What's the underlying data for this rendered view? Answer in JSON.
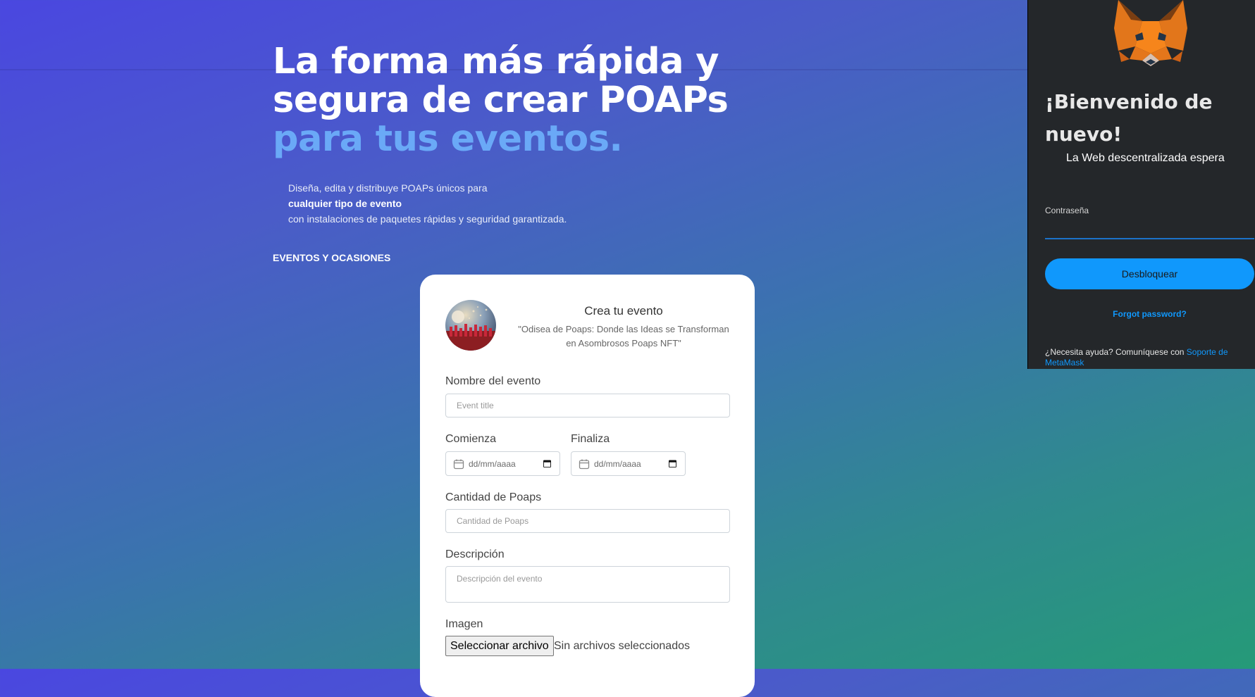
{
  "hero": {
    "line1": "La forma más rápida y",
    "line2": "segura de crear POAPs",
    "line3": "para tus eventos.",
    "desc1": "Diseña, edita y distribuye POAPs únicos para",
    "desc2": "cualquier tipo de evento",
    "desc3": "con instalaciones de paquetes rápidas y seguridad garantizada.",
    "section_label": "EVENTOS Y OCASIONES"
  },
  "form": {
    "title": "Crea tu evento",
    "subtitle": "\"Odisea de Poaps: Donde las Ideas se Transforman en Asombrosos Poaps NFT\"",
    "name_label": "Nombre del evento",
    "name_placeholder": "Event title",
    "start_label": "Comienza",
    "start_value": "dd/mm/aaaa",
    "end_label": "Finaliza",
    "end_value": "dd/mm/aaaa",
    "qty_label": "Cantidad de Poaps",
    "qty_placeholder": "Cantidad de Poaps",
    "desc_label": "Descripción",
    "desc_placeholder": "Descripción del evento",
    "image_label": "Imagen",
    "file_button": "Seleccionar archivo",
    "file_status": "Sin archivos seleccionados"
  },
  "metamask": {
    "title": "¡Bienvenido de nuevo!",
    "subtitle": "La Web descentralizada espera",
    "password_label": "Contraseña",
    "unlock_button": "Desbloquear",
    "forgot": "Forgot password?",
    "help_text": "¿Necesita ayuda? Comuníquese con ",
    "help_link": "Soporte de MetaMask"
  },
  "colors": {
    "accent_text": "#6aa9f7",
    "metamask_blue": "#1098fc",
    "metamask_bg": "#24272a"
  },
  "icons": [
    "calendar-icon",
    "date-picker-icon",
    "metamask-fox-icon",
    "event-avatar"
  ]
}
